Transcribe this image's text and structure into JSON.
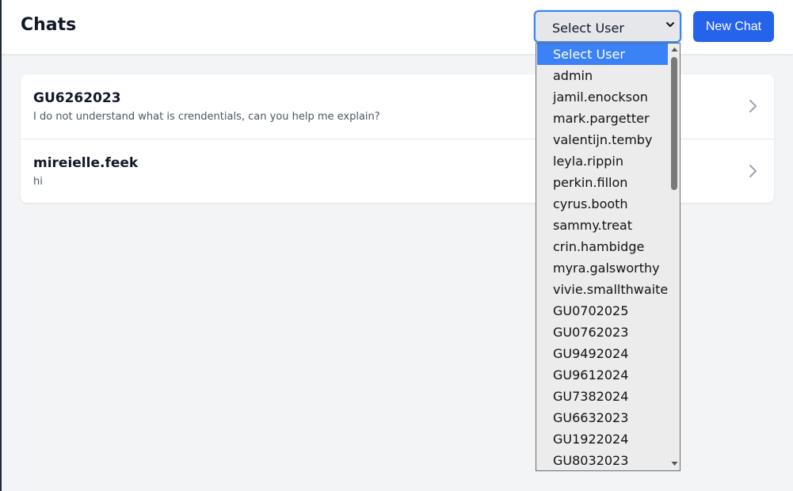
{
  "header": {
    "title": "Chats",
    "user_select": {
      "selected": "Select User",
      "options": [
        "Select User",
        "admin",
        "jamil.enockson",
        "mark.pargetter",
        "valentijn.temby",
        "leyla.rippin",
        "perkin.fillon",
        "cyrus.booth",
        "sammy.treat",
        "crin.hambidge",
        "myra.galsworthy",
        "vivie.smallthwaite",
        "GU0702025",
        "GU0762023",
        "GU9492024",
        "GU9612024",
        "GU7382024",
        "GU6632023",
        "GU1922024",
        "GU8032023"
      ]
    },
    "new_chat_label": "New Chat"
  },
  "chats": [
    {
      "name": "GU6262023",
      "preview": "I do not understand what is crendentials, can you help me explain?"
    },
    {
      "name": "mireielle.feek",
      "preview": "hi"
    }
  ],
  "colors": {
    "accent": "#2563eb",
    "selected_option": "#3b82f6",
    "background": "#f3f4f6"
  }
}
